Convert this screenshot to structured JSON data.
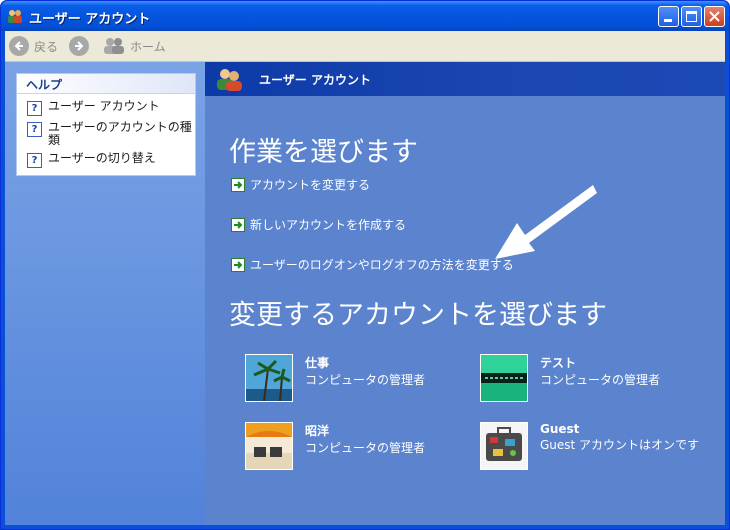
{
  "window": {
    "title": "ユーザー アカウント",
    "buttons": {
      "minimize": "−",
      "maximize": "□",
      "close": "✕"
    }
  },
  "toolbar": {
    "back_label": "戻る",
    "forward_icon": "forward-arrow-icon",
    "home_label": "ホーム"
  },
  "sidebar": {
    "help_title": "ヘルプ",
    "items": [
      {
        "label": "ユーザー アカウント"
      },
      {
        "label": "ユーザーのアカウントの種類"
      },
      {
        "label": "ユーザーの切り替え"
      }
    ]
  },
  "main": {
    "header_title": "ユーザー アカウント",
    "task_heading": "作業を選びます",
    "tasks": [
      {
        "label": "アカウントを変更する"
      },
      {
        "label": "新しいアカウントを作成する"
      },
      {
        "label": "ユーザーのログオンやログオフの方法を変更する"
      }
    ],
    "account_heading": "変更するアカウントを選びます",
    "accounts": [
      {
        "name": "仕事",
        "role": "コンピュータの管理者",
        "picture": "palm-trees"
      },
      {
        "name": "テスト",
        "role": "コンピュータの管理者",
        "picture": "green-abstract"
      },
      {
        "name": "昭洋",
        "role": "コンピュータの管理者",
        "picture": "beach-chairs"
      },
      {
        "name": "Guest",
        "role": "Guest アカウントはオンです",
        "picture": "suitcase"
      }
    ]
  },
  "colors": {
    "accent": "#0a4fd8",
    "pane": "#5b83ce",
    "sidebar": "#6b97e1"
  }
}
